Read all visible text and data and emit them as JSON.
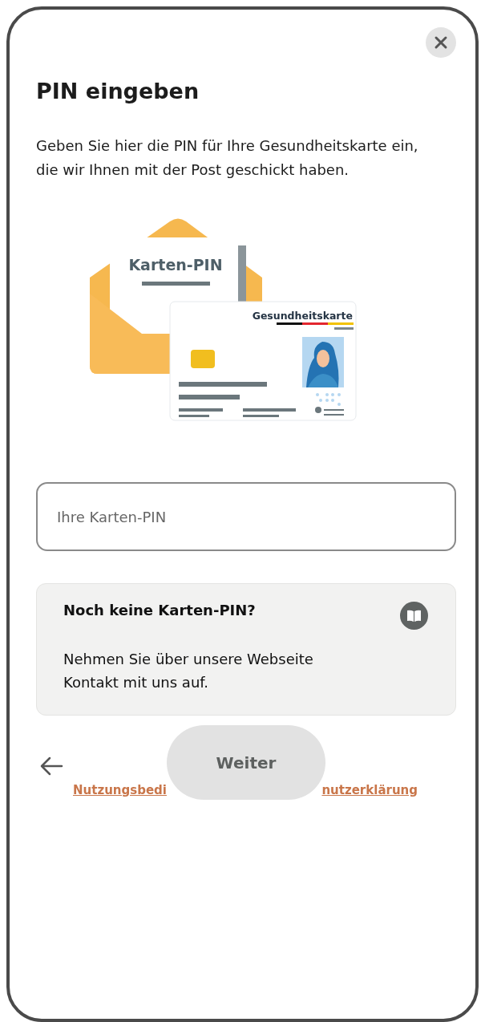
{
  "title": "PIN eingeben",
  "description": "Geben Sie hier die PIN für Ihre Gesundheitskarte ein, die wir Ihnen mit der Post geschickt haben.",
  "illustration": {
    "letter_label": "Karten-PIN",
    "card_label": "Gesundheitskarte"
  },
  "pin_field": {
    "placeholder": "Ihre Karten-PIN"
  },
  "info_card": {
    "heading": "Noch keine Karten-PIN?",
    "text": "Nehmen Sie über unsere Webseite Kontakt mit uns auf."
  },
  "primary_button": {
    "label": "Weiter",
    "disabled": true
  },
  "footer_links": [
    "Nutzungsbedi",
    "nutzerklärung"
  ]
}
